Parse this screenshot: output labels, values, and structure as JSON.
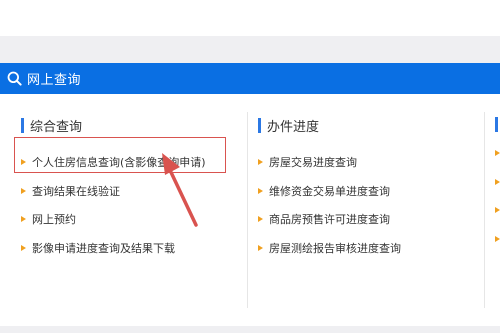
{
  "section_title": "网上查询",
  "columns": [
    {
      "title": "综合查询",
      "items": [
        "个人住房信息查询(含影像查询申请)",
        "查询结果在线验证",
        "网上预约",
        "影像申请进度查询及结果下载"
      ]
    },
    {
      "title": "办件进度",
      "items": [
        "房屋交易进度查询",
        "维修资金交易单进度查询",
        "商品房预售许可进度查询",
        "房屋测绘报告审核进度查询"
      ]
    }
  ],
  "colors": {
    "header_bar": "#0a6fe3",
    "accent_bar": "#2b78e4",
    "bullet": "#f0a020",
    "annotation": "#d9534f"
  },
  "icons": {
    "search": "search-icon",
    "bullet": "triangle-bullet-icon"
  }
}
